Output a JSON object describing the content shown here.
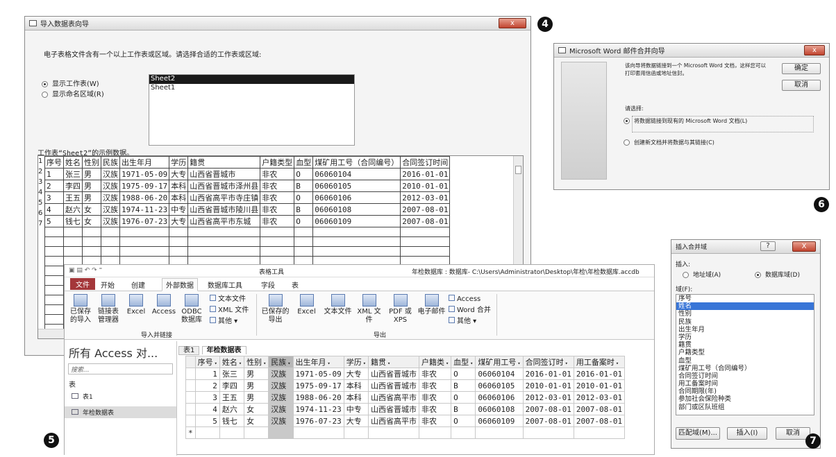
{
  "import_wizard": {
    "title": "导入数据表向导",
    "close": "x",
    "instruction": "电子表格文件含有一个以上工作表或区域。请选择合适的工作表或区域:",
    "opt_sheets": "显示工作表(W)",
    "opt_ranges": "显示命名区域(R)",
    "sheets": [
      "Sheet2",
      "Sheet1"
    ],
    "sample_label": "工作表“Sheet2”的示例数据。",
    "headers": [
      "序号",
      "姓名",
      "性别",
      "民族",
      "出生年月",
      "学历",
      "籍贯",
      "户籍类型",
      "血型",
      "煤矿用工号（合同编号）",
      "合同签订时间"
    ],
    "rows": [
      [
        "1",
        "张三",
        "男",
        "汉族",
        "1971-05-09",
        "大专",
        "山西省晋城市",
        "非农",
        "O",
        "06060104",
        "2016-01-01"
      ],
      [
        "2",
        "李四",
        "男",
        "汉族",
        "1975-09-17",
        "本科",
        "山西省晋城市泽州县",
        "非农",
        "B",
        "06060105",
        "2010-01-01"
      ],
      [
        "3",
        "王五",
        "男",
        "汉族",
        "1988-06-20",
        "本科",
        "山西省高平市寺庄镇",
        "非农",
        "O",
        "06060106",
        "2012-03-01"
      ],
      [
        "4",
        "赵六",
        "女",
        "汉族",
        "1974-11-23",
        "中专",
        "山西省晋城市陵川县",
        "非农",
        "B",
        "06060108",
        "2007-08-01"
      ],
      [
        "5",
        "钱七",
        "女",
        "汉族",
        "1976-07-23",
        "大专",
        "山西省高平市东城",
        "非农",
        "O",
        "06060109",
        "2007-08-01"
      ]
    ],
    "row_numbers": [
      "1",
      "2",
      "3",
      "4",
      "5",
      "6",
      "7"
    ]
  },
  "word_merge": {
    "title": "Microsoft Word 邮件合并向导",
    "close": "x",
    "desc": "该向导将数据链接到一个 Microsoft Word 文档，这样您可以打印套用信函或地址信封。",
    "ok": "确定",
    "cancel": "取消",
    "choose": "请选择:",
    "opt_existing": "将数据链接到现有的 Microsoft Word 文档(L)",
    "opt_new": "创建新文档并将数据与其链接(C)"
  },
  "insert_field": {
    "title": "插入合并域",
    "help": "?",
    "close": "X",
    "insert_label": "插入:",
    "opt_address": "地址域(A)",
    "opt_db": "数据库域(D)",
    "fields_label": "域(F):",
    "fields": [
      "序号",
      "姓名",
      "性别",
      "民族",
      "出生年月",
      "学历",
      "籍贯",
      "户籍类型",
      "血型",
      "煤矿用工号（合同编号）",
      "合同签订时间",
      "用工备案时间",
      "合同期限(年)",
      "参加社会保险种类",
      "部门或区队班组"
    ],
    "selected": "姓名",
    "match": "匹配域(M)...",
    "insert": "插入(I)",
    "cancel": "取消"
  },
  "access": {
    "context_tab": "表格工具",
    "title": "年检数据库 : 数据库- C:\\Users\\Administrator\\Desktop\\年检\\年检数据库.accdb",
    "tabs": [
      "文件",
      "开始",
      "创建",
      "外部数据",
      "数据库工具",
      "字段",
      "表"
    ],
    "import_items": [
      "已保存的导入",
      "链接表管理器",
      "Excel",
      "Access",
      "ODBC 数据库"
    ],
    "import_more": [
      "文本文件",
      "XML 文件",
      "其他 ▾"
    ],
    "import_group": "导入并链接",
    "export_items": [
      "已保存的导出",
      "Excel",
      "文本文件",
      "XML 文件",
      "PDF 或 XPS",
      "电子邮件"
    ],
    "export_more": [
      "Access",
      "Word 合并",
      "其他 ▾"
    ],
    "export_group": "导出",
    "nav_title": "所有 Access 对...",
    "search": "搜索...",
    "nav_section": "表",
    "nav_items": [
      "表1",
      "年检数据表"
    ],
    "doc_tabs": [
      "表1",
      "年检数据表"
    ],
    "columns": [
      "序号",
      "姓名",
      "性别",
      "民族",
      "出生年月",
      "学历",
      "籍贯",
      "户籍类",
      "血型",
      "煤矿用工号",
      "合同签订时",
      "用工备案时"
    ],
    "rows": [
      [
        "1",
        "张三",
        "男",
        "汉族",
        "1971-05-09",
        "大专",
        "山西省晋城市",
        "非农",
        "O",
        "06060104",
        "2016-01-01",
        "2016-01-01"
      ],
      [
        "2",
        "李四",
        "男",
        "汉族",
        "1975-09-17",
        "本科",
        "山西省晋城市",
        "非农",
        "B",
        "06060105",
        "2010-01-01",
        "2010-01-01"
      ],
      [
        "3",
        "王五",
        "男",
        "汉族",
        "1988-06-20",
        "本科",
        "山西省高平市",
        "非农",
        "O",
        "06060106",
        "2012-03-01",
        "2012-03-01"
      ],
      [
        "4",
        "赵六",
        "女",
        "汉族",
        "1974-11-23",
        "中专",
        "山西省晋城市",
        "非农",
        "B",
        "06060108",
        "2007-08-01",
        "2007-08-01"
      ],
      [
        "5",
        "钱七",
        "女",
        "汉族",
        "1976-07-23",
        "大专",
        "山西省高平市",
        "非农",
        "O",
        "06060109",
        "2007-08-01",
        "2007-08-01"
      ]
    ],
    "new_row": "*"
  },
  "badges": [
    "4",
    "5",
    "6",
    "7"
  ]
}
